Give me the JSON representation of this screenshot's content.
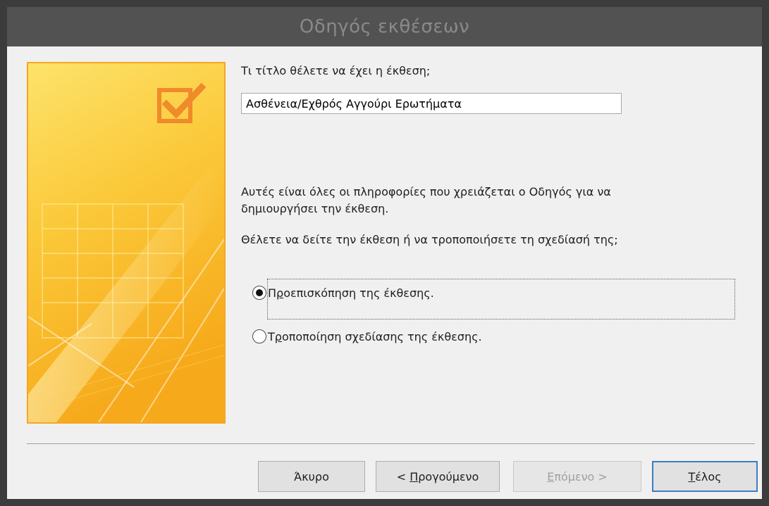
{
  "window": {
    "title": "Οδηγός εκθέσεων"
  },
  "title_prompt": "Τι τίτλο θέλετε να έχει η έκθεση;",
  "title_input": {
    "value": "Ασθένεια/Εχθρός Αγγούρι Ερωτήματα"
  },
  "info_line1": "Αυτές είναι όλες οι πληροφορίες που χρειάζεται ο Οδηγός για να",
  "info_line2": "δημιουργήσει την έκθεση.",
  "question": "Θέλετε να δείτε την έκθεση ή να τροποποιήσετε τη σχεδίασή της;",
  "options": [
    {
      "first": "Π",
      "mnemonic": "ρ",
      "rest": "οεπισκόπηση της έκθεσης.",
      "selected": true
    },
    {
      "first": "Τ",
      "mnemonic": "ρ",
      "rest": "οποποίηση σχεδίασης της έκθεσης.",
      "selected": false
    }
  ],
  "buttons": {
    "cancel": {
      "label": "Άκυρο"
    },
    "back": {
      "prefix": "< ",
      "mnemonic": "Π",
      "rest": "ρογούμενο"
    },
    "next": {
      "mnemonic": "Ε",
      "rest": "πόμενο >",
      "disabled": true
    },
    "finish": {
      "mnemonic": "Τ",
      "rest": "έλος"
    }
  },
  "colors": {
    "art_border": "#f5a623",
    "art_top": "#fcd94a",
    "art_bottom": "#f7b21d",
    "default_button_border": "#3c7fc1"
  },
  "icons": {
    "art_check": "checkbox-check-icon"
  }
}
